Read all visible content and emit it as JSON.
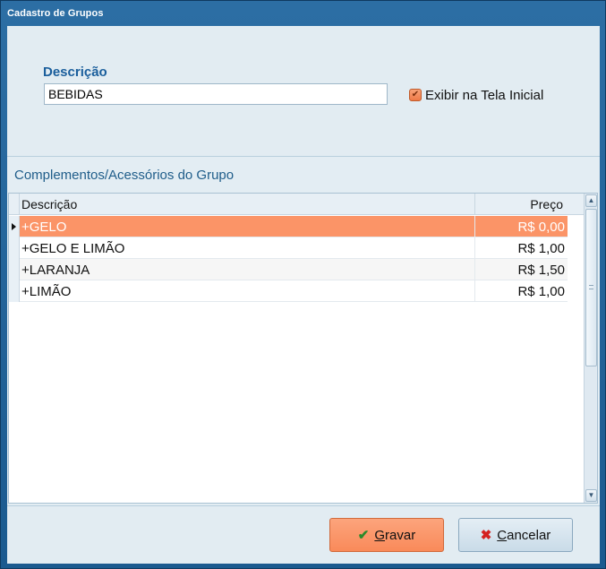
{
  "window": {
    "title": "Cadastro de Grupos"
  },
  "form": {
    "description_label": "Descrição",
    "description_value": "BEBIDAS",
    "show_on_home_label": "Exibir na Tela Inicial",
    "show_on_home_checked": true
  },
  "complements": {
    "title": "Complementos/Acessórios do Grupo",
    "columns": {
      "description": "Descrição",
      "price": "Preço"
    },
    "rows": [
      {
        "description": "+GELO",
        "price": "R$ 0,00"
      },
      {
        "description": "+GELO E LIMÃO",
        "price": "R$ 1,00"
      },
      {
        "description": "+LARANJA",
        "price": "R$ 1,50"
      },
      {
        "description": "+LIMÃO",
        "price": "R$ 1,00"
      }
    ]
  },
  "buttons": {
    "save_label": "Gravar",
    "save_accel": "G",
    "save_rest": "ravar",
    "cancel_label": "Cancelar",
    "cancel_accel": "C",
    "cancel_rest": "ancelar"
  },
  "icons": {
    "save": "check-icon",
    "cancel": "x-icon"
  },
  "colors": {
    "title_bar": "#1b5a8f",
    "accent_label": "#1a5e9c",
    "selected_row": "#fb9467",
    "save_button": "#f98a5a"
  }
}
